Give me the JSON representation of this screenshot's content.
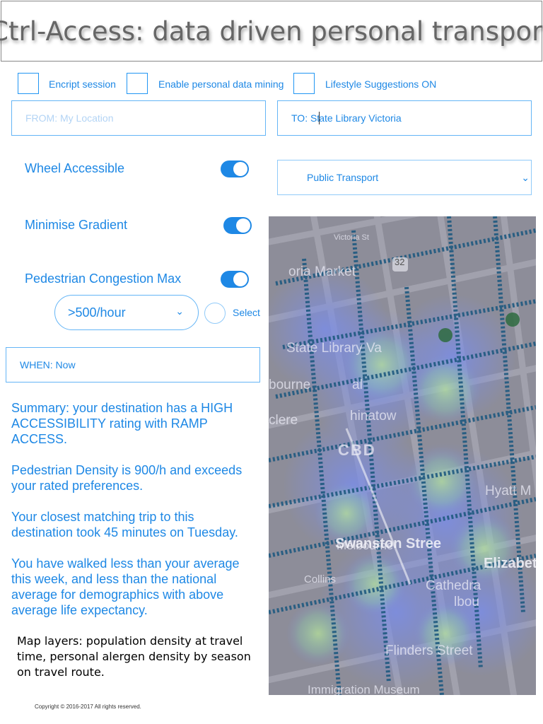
{
  "header": {
    "title": "Ctrl-Access: data driven personal transport"
  },
  "options": {
    "encrypt": {
      "label": "Encript session"
    },
    "mining": {
      "label": "Enable personal data mining"
    },
    "lifestyle": {
      "label": "Lifestyle Suggestions ON"
    }
  },
  "route": {
    "from_placeholder": "FROM: My Location",
    "to_value_a": "TO: St",
    "to_value_b": "ate Library Victoria"
  },
  "mode_select": {
    "selected": "Public Transport",
    "chevron": "⌄"
  },
  "prefs": {
    "wheel": {
      "label": "Wheel Accessible",
      "on": true
    },
    "gradient": {
      "label": "Minimise Gradient",
      "on": true
    },
    "congestion": {
      "label": "Pedestrian Congestion Max",
      "on": true,
      "threshold": ">500/hour",
      "chevron": "⌄"
    },
    "select_label": "Select"
  },
  "when": {
    "value": "WHEN: Now"
  },
  "summary": {
    "lines": [
      "Summary: your destination has a HIGH ACCESSIBILITY rating with RAMP ACCESS.",
      "Pedestrian Density is 900/h and exceeds your rated preferences.",
      "Your closest matching trip to this destination took 45 minutes on Tuesday.",
      "You have walked less than your average this week, and less than the national average for demographics with above average life expectancy."
    ]
  },
  "map_caption": "Map layers: population density at travel time, personal alergen density by season on travel route.",
  "copyright": "Copyright © 2016-2017 All rights reserved.",
  "map": {
    "labels": {
      "market": "oria Market",
      "library": "State Library Va",
      "bourne1": "bourne",
      "central": "al",
      "chinatown": "hinatow",
      "cbd": "CBD",
      "clere": "clere",
      "hyatt": "Hyatt M",
      "melbourne": "Melbourne",
      "swanston": "Swanston Stree",
      "elizabeth": "Elizabet",
      "collins": "Collins",
      "cathedral": "Cathedra",
      "bourne2": "lbou",
      "flinders": "Flinders Street",
      "immigration": "Immigration Museum",
      "victoria_st": "Victoria St",
      "route32": "32"
    },
    "colors": {
      "base": "#8f8f9a",
      "heat_blue": "#6f7fd8",
      "heat_green": "#9fd48a",
      "dots": "#1d4f75"
    }
  }
}
